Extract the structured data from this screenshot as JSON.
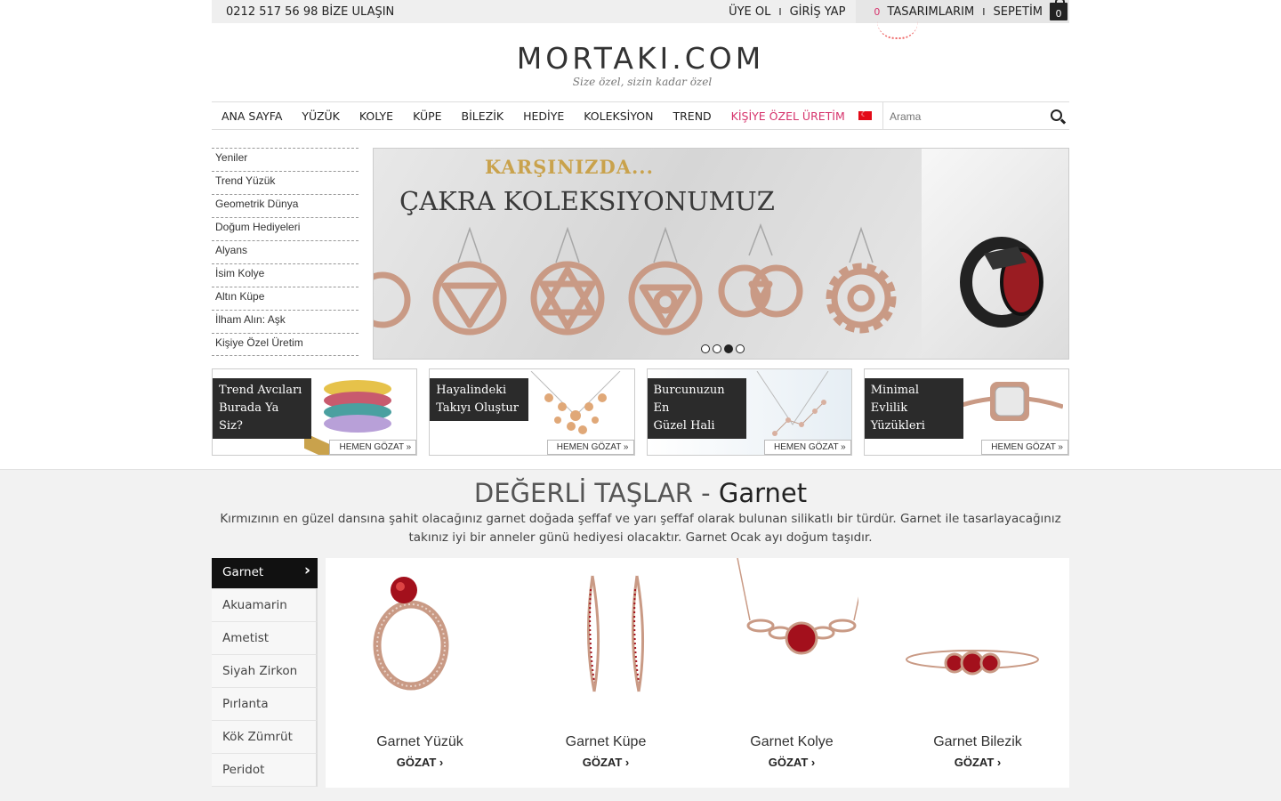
{
  "topbar": {
    "phone": "0212 517 56 98 BİZE ULAŞIN",
    "register": "ÜYE OL",
    "login": "GİRİŞ YAP",
    "sep": "I",
    "designs_count": "0",
    "designs": "TASARIMLARIM",
    "cart": "SEPETİM",
    "cart_count": "0"
  },
  "brand": {
    "logo": "MORTAKI.COM",
    "tagline": "Size özel, sizin kadar özel"
  },
  "nav": {
    "items": [
      "ANA SAYFA",
      "YÜZÜK",
      "KOLYE",
      "KÜPE",
      "BİLEZİK",
      "HEDİYE",
      "KOLEKSİYON",
      "TREND",
      "KİŞİYE ÖZEL ÜRETİM"
    ],
    "search_placeholder": "Arama"
  },
  "sidebar": [
    "Yeniler",
    "Trend Yüzük",
    "Geometrik Dünya",
    "Doğum Hediyeleri",
    "Alyans",
    "İsim Kolye",
    "Altın Küpe",
    "İlham Alın: Aşk",
    "Kişiye Özel Üretim"
  ],
  "hero": {
    "line1": "KARŞINIZDA...",
    "line2": "ÇAKRA KOLEKSIYONUMUZ",
    "slide_count": 4,
    "active_slide": 3
  },
  "tiles": [
    {
      "line1": "Trend Avcıları",
      "line2": "Burada Ya Siz?",
      "cta": "HEMEN GÖZAT »"
    },
    {
      "line1": "Hayalindeki",
      "line2": "Takıyı Oluştur",
      "cta": "HEMEN GÖZAT »"
    },
    {
      "line1": "Burcunuzun En",
      "line2": "Güzel Hali",
      "cta": "HEMEN GÖZAT »"
    },
    {
      "line1": "Minimal Evlilik",
      "line2": "Yüzükleri",
      "cta": "HEMEN GÖZAT »"
    }
  ],
  "gems": {
    "title_prefix": "DEĞERLİ TAŞLAR - ",
    "title_main": "Garnet",
    "description": "Kırmızının en güzel dansına şahit olacağınız garnet doğada şeffaf ve yarı şeffaf olarak bulunan silikatlı bir türdür. Garnet ile tasarlayacağınız takınız iyi bir anneler günü hediyesi olacaktır. Garnet Ocak ayı doğum taşıdır.",
    "list": [
      "Garnet",
      "Akuamarin",
      "Ametist",
      "Siyah Zirkon",
      "Pırlanta",
      "Kök Zümrüt",
      "Peridot"
    ],
    "products": [
      {
        "name": "Garnet Yüzük",
        "cta": "GÖZAT ›"
      },
      {
        "name": "Garnet Küpe",
        "cta": "GÖZAT ›"
      },
      {
        "name": "Garnet Kolye",
        "cta": "GÖZAT ›"
      },
      {
        "name": "Garnet Bilezik",
        "cta": "GÖZAT ›"
      }
    ]
  },
  "colors": {
    "accent": "#d6336c",
    "dark": "#111111",
    "rose_gold": "#c99a85",
    "garnet": "#a3101c"
  }
}
